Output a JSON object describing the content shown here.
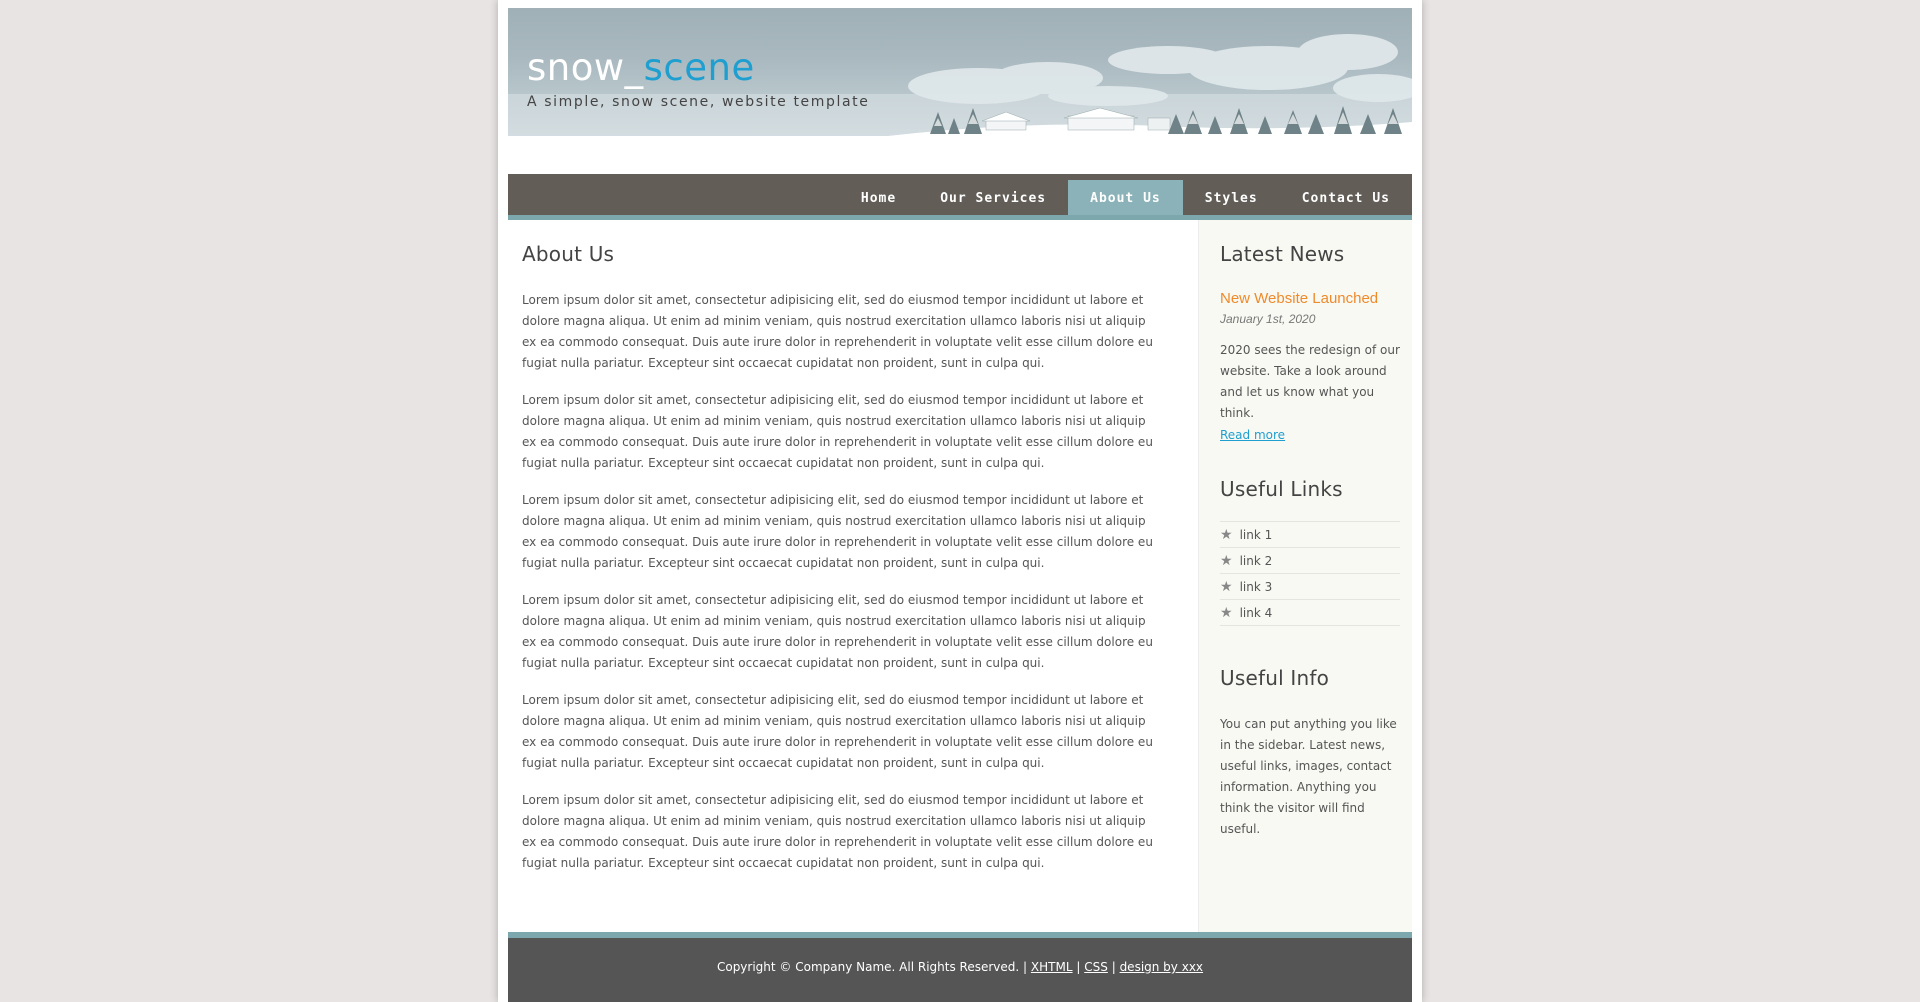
{
  "header": {
    "logo_main": "snow_",
    "logo_accent": "scene",
    "slogan": "A simple, snow scene, website template"
  },
  "menu": {
    "items": [
      {
        "label": "Home"
      },
      {
        "label": "Our Services"
      },
      {
        "label": "About Us",
        "selected": true
      },
      {
        "label": "Styles"
      },
      {
        "label": "Contact Us"
      }
    ]
  },
  "content": {
    "title": "About Us",
    "paragraphs": [
      "Lorem ipsum dolor sit amet, consectetur adipisicing elit, sed do eiusmod tempor incididunt ut labore et dolore magna aliqua. Ut enim ad minim veniam, quis nostrud exercitation ullamco laboris nisi ut aliquip ex ea commodo consequat. Duis aute irure dolor in reprehenderit in voluptate velit esse cillum dolore eu fugiat nulla pariatur. Excepteur sint occaecat cupidatat non proident, sunt in culpa qui.",
      "Lorem ipsum dolor sit amet, consectetur adipisicing elit, sed do eiusmod tempor incididunt ut labore et dolore magna aliqua. Ut enim ad minim veniam, quis nostrud exercitation ullamco laboris nisi ut aliquip ex ea commodo consequat. Duis aute irure dolor in reprehenderit in voluptate velit esse cillum dolore eu fugiat nulla pariatur. Excepteur sint occaecat cupidatat non proident, sunt in culpa qui.",
      "Lorem ipsum dolor sit amet, consectetur adipisicing elit, sed do eiusmod tempor incididunt ut labore et dolore magna aliqua. Ut enim ad minim veniam, quis nostrud exercitation ullamco laboris nisi ut aliquip ex ea commodo consequat. Duis aute irure dolor in reprehenderit in voluptate velit esse cillum dolore eu fugiat nulla pariatur. Excepteur sint occaecat cupidatat non proident, sunt in culpa qui.",
      "Lorem ipsum dolor sit amet, consectetur adipisicing elit, sed do eiusmod tempor incididunt ut labore et dolore magna aliqua. Ut enim ad minim veniam, quis nostrud exercitation ullamco laboris nisi ut aliquip ex ea commodo consequat. Duis aute irure dolor in reprehenderit in voluptate velit esse cillum dolore eu fugiat nulla pariatur. Excepteur sint occaecat cupidatat non proident, sunt in culpa qui.",
      "Lorem ipsum dolor sit amet, consectetur adipisicing elit, sed do eiusmod tempor incididunt ut labore et dolore magna aliqua. Ut enim ad minim veniam, quis nostrud exercitation ullamco laboris nisi ut aliquip ex ea commodo consequat. Duis aute irure dolor in reprehenderit in voluptate velit esse cillum dolore eu fugiat nulla pariatur. Excepteur sint occaecat cupidatat non proident, sunt in culpa qui.",
      "Lorem ipsum dolor sit amet, consectetur adipisicing elit, sed do eiusmod tempor incididunt ut labore et dolore magna aliqua. Ut enim ad minim veniam, quis nostrud exercitation ullamco laboris nisi ut aliquip ex ea commodo consequat. Duis aute irure dolor in reprehenderit in voluptate velit esse cillum dolore eu fugiat nulla pariatur. Excepteur sint occaecat cupidatat non proident, sunt in culpa qui."
    ]
  },
  "sidebar": {
    "news": {
      "heading": "Latest News",
      "item_title": "New Website Launched",
      "item_date": "January 1st, 2020",
      "item_text": "2020 sees the redesign of our website. Take a look around and let us know what you think.",
      "read_more": "Read more"
    },
    "links": {
      "heading": "Useful Links",
      "items": [
        "link 1",
        "link 2",
        "link 3",
        "link 4"
      ]
    },
    "info": {
      "heading": "Useful Info",
      "text": "You can put anything you like in the sidebar. Latest news, useful links, images, contact information. Anything you think the visitor will find useful."
    }
  },
  "footer": {
    "copyright": "Copyright © Company Name. All Rights Reserved.",
    "sep": "|",
    "links": [
      "XHTML",
      "CSS",
      "design by xxx"
    ]
  },
  "colors": {
    "accent": "#1f9fcf",
    "menu_bg": "#625d57",
    "menu_selected": "#8ab2b8",
    "news_title": "#ef8a2b",
    "footer_bg": "#555555"
  }
}
